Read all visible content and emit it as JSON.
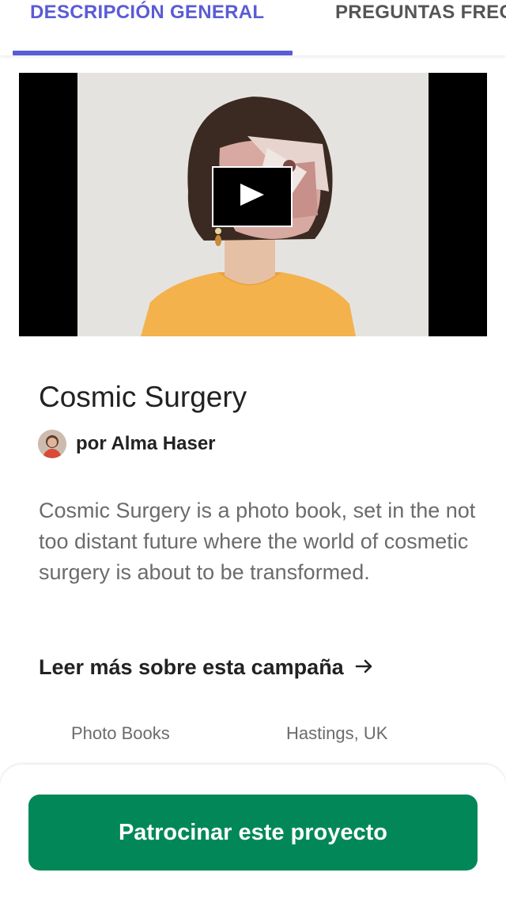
{
  "tabs": [
    {
      "label": "DESCRIPCIÓN GENERAL",
      "active": true
    },
    {
      "label": "PREGUNTAS FRECUENTES",
      "active": false
    }
  ],
  "colors": {
    "accent": "#5b5bd6",
    "cta": "#028858",
    "text_primary": "#222222",
    "text_secondary": "#6b6b6b"
  },
  "video": {
    "play_icon": "play-icon"
  },
  "project": {
    "title": "Cosmic Surgery",
    "creator": "por Alma Haser",
    "description": "Cosmic Surgery is a photo book, set in the not too distant future where the world of cosmetic surgery is about to be transformed.",
    "read_more": "Leer más sobre esta campaña",
    "read_more_icon": "arrow-right-icon",
    "category": "Photo Books",
    "location": "Hastings, UK"
  },
  "cta": {
    "label": "Patrocinar este proyecto"
  }
}
